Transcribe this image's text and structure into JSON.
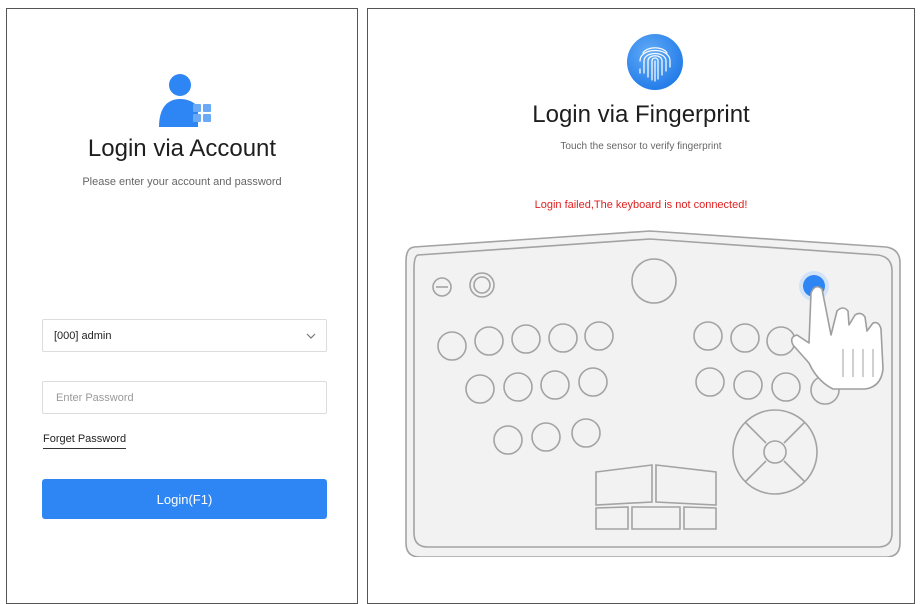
{
  "account_login": {
    "title": "Login via Account",
    "subtitle": "Please enter your account and password",
    "account_value": "[000] admin",
    "password_placeholder": "Enter Password",
    "forget_password": "Forget Password",
    "login_button": "Login(F1)",
    "icon": "user-account-icon"
  },
  "fingerprint_login": {
    "title": "Login via Fingerprint",
    "subtitle": "Touch the sensor to verify fingerprint",
    "error_message": "Login failed,The keyboard is not connected!",
    "icon": "fingerprint-icon"
  },
  "colors": {
    "accent": "#2e86f5",
    "error": "#e02020"
  }
}
